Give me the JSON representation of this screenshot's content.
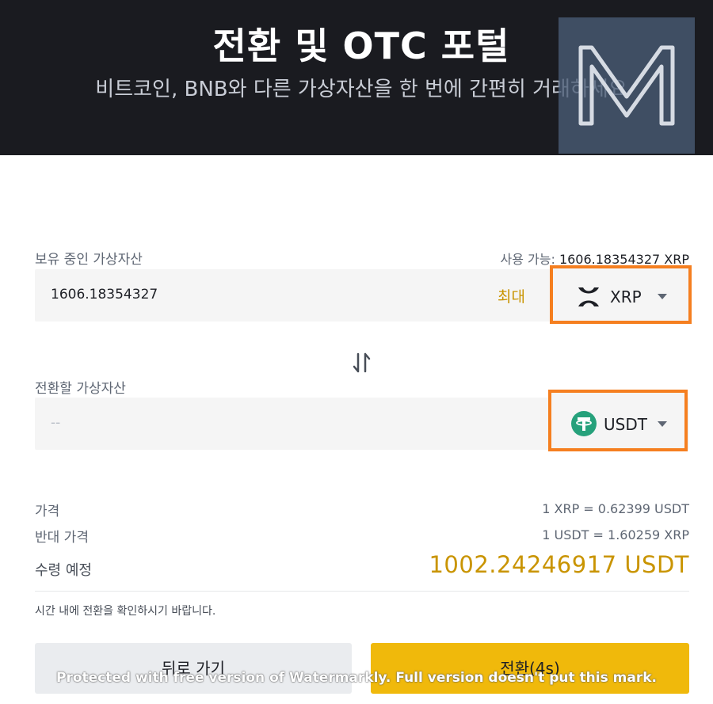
{
  "header": {
    "title": "전환 및 OTC 포털",
    "subtitle": "비트코인, BNB와 다른 가상자산을 한 번에 간편히 거래하세요",
    "logo_letter": "M"
  },
  "from": {
    "label": "보유 중인 가상자산",
    "available_label": "사용 가능:",
    "available_value": "1606.18354327 XRP",
    "amount": "1606.18354327",
    "max_label": "최대",
    "coin": "XRP",
    "coin_icon": "xrp-icon"
  },
  "to": {
    "label": "전환할 가상자산",
    "amount_placeholder": "--",
    "coin": "USDT",
    "coin_icon": "tether-icon"
  },
  "summary": {
    "price_label": "가격",
    "price_value": "1 XRP = 0.62399 USDT",
    "inverse_label": "반대 가격",
    "inverse_value": "1 USDT = 1.60259 XRP",
    "receive_label": "수령 예정",
    "receive_value": "1002.24246917 USDT"
  },
  "note": "시간 내에 전환을 확인하시기 바랍니다.",
  "buttons": {
    "back": "뒤로 가기",
    "convert": "전환(4s)"
  },
  "watermark": "Protected with free version of Watermarkly. Full version doesn't put this mark.",
  "colors": {
    "accent": "#f0b90b",
    "highlight_border": "#f57f20",
    "gold_text": "#c99400",
    "tether_green": "#26a17b"
  }
}
